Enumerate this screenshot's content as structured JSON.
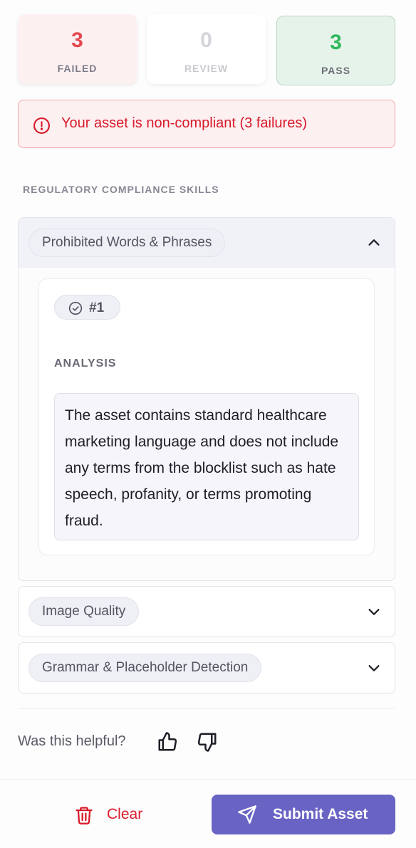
{
  "stats": {
    "failed": {
      "count": "3",
      "label": "FAILED",
      "color": "#e5484d"
    },
    "review": {
      "count": "0",
      "label": "REVIEW",
      "color": "#d4d4da"
    },
    "pass": {
      "count": "3",
      "label": "PASS",
      "color": "#2eb85c"
    }
  },
  "alert": {
    "icon": "alert-circle-icon",
    "message": "Your asset is non-compliant (3 failures)",
    "color": "#d81a2a"
  },
  "section_title": "REGULATORY COMPLIANCE SKILLS",
  "skills": [
    {
      "name": "Prohibited Words & Phrases",
      "expanded": true,
      "result": {
        "badge": "#1",
        "badge_icon": "check-circle-icon",
        "analysis_label": "ANALYSIS",
        "analysis_text": "The asset contains standard healthcare marketing language and does not include any terms from the blocklist such as hate speech, profanity, or terms promoting fraud."
      }
    },
    {
      "name": "Image Quality",
      "expanded": false
    },
    {
      "name": "Grammar & Placeholder Detection",
      "expanded": false
    }
  ],
  "feedback": {
    "question": "Was this helpful?",
    "up_icon": "thumbs-up-icon",
    "down_icon": "thumbs-down-icon"
  },
  "actions": {
    "clear_label": "Clear",
    "clear_icon": "trash-icon",
    "submit_label": "Submit Asset",
    "submit_icon": "send-icon",
    "accent": "#6963c4"
  }
}
